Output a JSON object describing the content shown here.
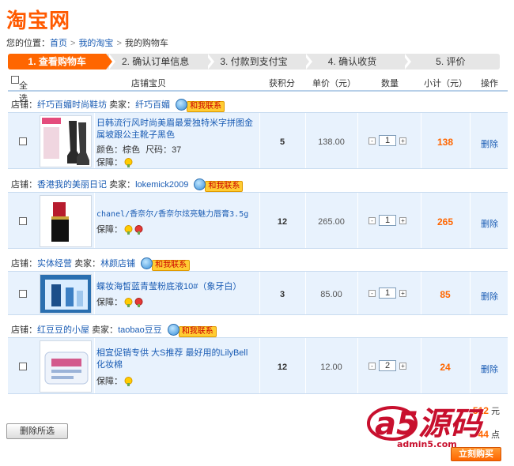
{
  "logo": {
    "text": "淘宝网"
  },
  "breadcrumb": {
    "prefix": "您的位置：",
    "home": "首页",
    "my": "我的淘宝",
    "current": "我的购物车"
  },
  "steps": [
    {
      "label": "1. 查看购物车",
      "active": true
    },
    {
      "label": "2. 确认订单信息",
      "active": false
    },
    {
      "label": "3. 付款到支付宝",
      "active": false
    },
    {
      "label": "4. 确认收货",
      "active": false
    },
    {
      "label": "5. 评价",
      "active": false
    }
  ],
  "table_header": {
    "select_all": "全选",
    "item": "店铺宝贝",
    "points": "获积分",
    "unit_price": "单价（元）",
    "quantity": "数量",
    "subtotal": "小计（元）",
    "action": "操作"
  },
  "labels": {
    "shop": "店铺：",
    "seller": "卖家：",
    "chat": "和我联系",
    "color": "颜色：",
    "size": "尺码：",
    "guarantee": "保障：",
    "delete": "删除",
    "minus": "-",
    "plus": "+"
  },
  "items": [
    {
      "shop": "纤巧百媚时尚鞋坊",
      "seller": "纤巧百媚",
      "title": "日韩流行风时尚美眉最爱独特米字拼图金属坡跟公主靴子黑色",
      "color": "棕色",
      "size": "37",
      "points": "5",
      "unit_price": "138.00",
      "quantity": "1",
      "subtotal": "138"
    },
    {
      "shop": "香港我的美丽日记",
      "seller": "lokemick2009",
      "title": "chanel/香奈尔/香奈尔炫亮魅力唇膏3.5g",
      "points": "12",
      "unit_price": "265.00",
      "quantity": "1",
      "subtotal": "265"
    },
    {
      "shop": "实体经营",
      "seller": "林颜店铺",
      "title": "蝶妆海皙蓝青莹粉底液10#（象牙白）",
      "points": "3",
      "unit_price": "85.00",
      "quantity": "1",
      "subtotal": "85"
    },
    {
      "shop": "红豆豆的小屋",
      "seller": "taobao豆豆",
      "title": "相宜促销专供 大S推荐 最好用的LilyBell化妆棉",
      "points": "12",
      "unit_price": "12.00",
      "quantity": "2",
      "subtotal": "24"
    }
  ],
  "footer": {
    "delete_selected": "删除所选",
    "total_value": "512",
    "total_unit": "元",
    "points_value": "44",
    "points_unit": "点",
    "buy_now": "立刻购买"
  },
  "watermark": {
    "brand": "a5源码",
    "site": "admin5.com"
  },
  "colors": {
    "accent": "#ff6600",
    "link": "#1a5cb4",
    "row_bg": "#e8f2fd"
  }
}
